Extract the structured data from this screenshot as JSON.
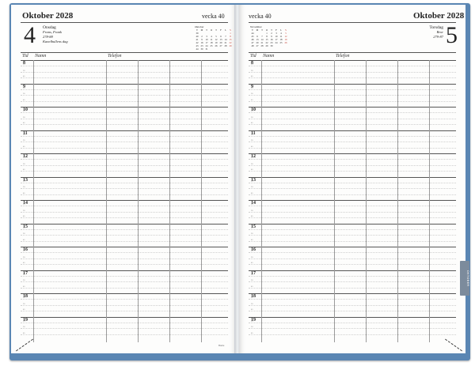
{
  "left_page": {
    "month_year": "Oktober 2028",
    "week": "vecka 40",
    "day_number": "4",
    "weekday": "Onsdag",
    "name_days": "Frans, Frank",
    "day_of_year": "278-88",
    "theme_day": "Kanelbullens dag",
    "mini_calendar": {
      "title": "Oktober",
      "headers": [
        "V",
        "M",
        "T",
        "O",
        "T",
        "F",
        "L",
        "S"
      ],
      "rows": [
        [
          "39",
          "",
          "",
          "",
          "",
          "",
          "",
          "1"
        ],
        [
          "40",
          "2",
          "3",
          "4",
          "5",
          "6",
          "7",
          "8"
        ],
        [
          "41",
          "9",
          "10",
          "11",
          "12",
          "13",
          "14",
          "15"
        ],
        [
          "42",
          "16",
          "17",
          "18",
          "19",
          "20",
          "21",
          "22"
        ],
        [
          "43",
          "23",
          "24",
          "25",
          "26",
          "27",
          "28",
          "29"
        ],
        [
          "44",
          "30",
          "31",
          "",
          "",
          "",
          "",
          ""
        ]
      ]
    },
    "columns": {
      "time": "Tid",
      "name": "Namn",
      "phone": "Telefon"
    },
    "brand": "Burde"
  },
  "right_page": {
    "month_year": "Oktober 2028",
    "week": "vecka 40",
    "day_number": "5",
    "weekday": "Torsdag",
    "name_days": "Bror",
    "day_of_year": "279-87",
    "mini_calendar": {
      "title": "November",
      "headers": [
        "V",
        "M",
        "T",
        "O",
        "T",
        "F",
        "L",
        "S"
      ],
      "rows": [
        [
          "44",
          "",
          "",
          "1",
          "2",
          "3",
          "4",
          "5"
        ],
        [
          "45",
          "6",
          "7",
          "8",
          "9",
          "10",
          "11",
          "12"
        ],
        [
          "46",
          "13",
          "14",
          "15",
          "16",
          "17",
          "18",
          "19"
        ],
        [
          "47",
          "20",
          "21",
          "22",
          "23",
          "24",
          "25",
          "26"
        ],
        [
          "48",
          "27",
          "28",
          "29",
          "30",
          "",
          "",
          ""
        ]
      ]
    },
    "columns": {
      "time": "Tid",
      "name": "Namn",
      "phone": "Telefon"
    },
    "tab_label": "OKTOBER"
  },
  "hours": [
    "8",
    "9",
    "10",
    "11",
    "12",
    "13",
    "14",
    "15",
    "16",
    "17",
    "18",
    "19"
  ],
  "quarter_marks": [
    "15",
    "30",
    "45"
  ],
  "colors": {
    "cover": "#5a86b3",
    "paper": "#fdfdfc",
    "sunday": "#c0392b",
    "tab": "#7c8b9c"
  }
}
